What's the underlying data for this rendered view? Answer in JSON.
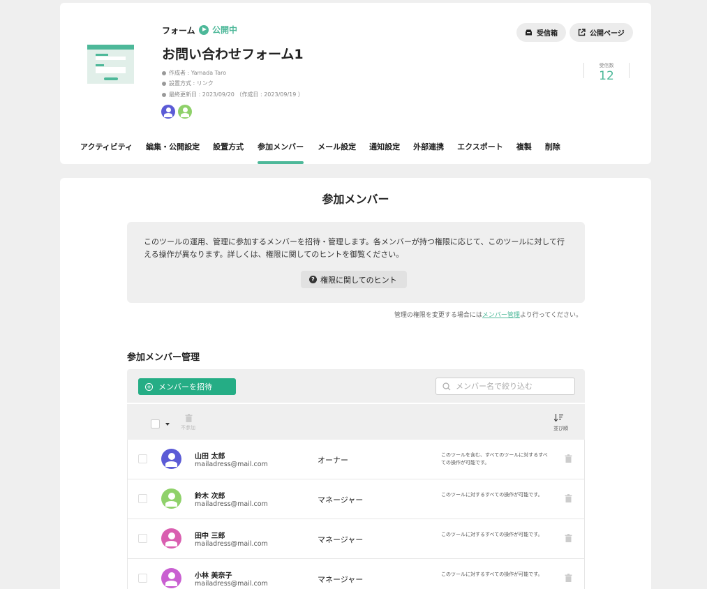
{
  "header": {
    "type_label": "フォーム",
    "status": "公開中",
    "title": "お問い合わせフォーム1",
    "meta": [
      "作成者 : Yamada Taro",
      "設置方式 : リンク",
      "最終更新日 : 2023/09/20 （作成日 : 2023/09/19 ）"
    ],
    "inbox_button": "受信箱",
    "public_page_button": "公開ページ",
    "received_label": "受信数",
    "received_count": "12",
    "colors": {
      "accent": "#4db899",
      "avatar_1": "#5b5bd6",
      "avatar_2": "#8fd16a"
    }
  },
  "tabs": [
    {
      "label": "アクティビティ",
      "active": false
    },
    {
      "label": "編集・公開設定",
      "active": false
    },
    {
      "label": "設置方式",
      "active": false
    },
    {
      "label": "参加メンバー",
      "active": true
    },
    {
      "label": "メール設定",
      "active": false
    },
    {
      "label": "通知設定",
      "active": false
    },
    {
      "label": "外部連携",
      "active": false
    },
    {
      "label": "エクスポート",
      "active": false
    },
    {
      "label": "複製",
      "active": false
    },
    {
      "label": "削除",
      "active": false
    }
  ],
  "main": {
    "heading": "参加メンバー",
    "info_text": "このツールの運用、管理に参加するメンバーを招待・管理します。各メンバーが持つ権限に応じて、このツールに対して行える操作が異なります。詳しくは、権限に関してのヒントを御覧ください。",
    "hint_button": "権限に関してのヒント",
    "note_before": "管理の権限を変更する場合には",
    "note_link": "メンバー管理",
    "note_after": "より行ってください。",
    "section_title": "参加メンバー管理",
    "invite_button": "メンバーを招待",
    "search_placeholder": "メンバー名で絞り込む",
    "leave_label": "不参加",
    "sort_label": "並び順"
  },
  "members": [
    {
      "name": "山田 太郎",
      "email": "mailadress@mail.com",
      "role": "オーナー",
      "desc": "このツールを含む、すべてのツールに対するすべての操作が可能です。",
      "color": "#5b5bd6"
    },
    {
      "name": "鈴木 次郎",
      "email": "mailadress@mail.com",
      "role": "マネージャー",
      "desc": "このツールに対するすべての操作が可能です。",
      "color": "#8fd16a"
    },
    {
      "name": "田中 三郎",
      "email": "mailadress@mail.com",
      "role": "マネージャー",
      "desc": "このツールに対するすべての操作が可能です。",
      "color": "#d95fb0"
    },
    {
      "name": "小林 美奈子",
      "email": "mailadress@mail.com",
      "role": "マネージャー",
      "desc": "このツールに対するすべての操作が可能です。",
      "color": "#c95fd1"
    }
  ]
}
